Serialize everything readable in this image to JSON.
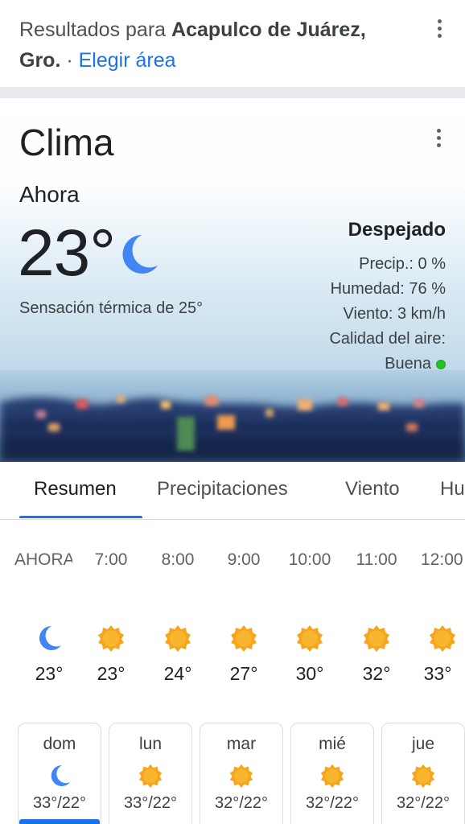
{
  "header": {
    "results_prefix": "Resultados para ",
    "location_line1": "Acapulco de Juárez,",
    "location_line2": "Gro.",
    "separator": " · ",
    "change_area": "Elegir área",
    "menu_icon": "more-vert-icon"
  },
  "weather": {
    "title": "Clima",
    "menu_icon": "more-vert-icon",
    "now_label": "Ahora",
    "temperature": "23°",
    "condition_icon": "moon-icon",
    "feels_like": "Sensación térmica de 25°",
    "condition": "Despejado",
    "precip": "Precip.: 0 %",
    "humidity": "Humedad: 76 %",
    "wind": "Viento: 3 km/h",
    "air_quality_label": "Calidad del aire:",
    "air_quality_value": "Buena",
    "air_quality_color": "#1ec71e"
  },
  "tabs": [
    {
      "label": "Resumen",
      "active": true
    },
    {
      "label": "Precipitaciones",
      "active": false
    },
    {
      "label": "Viento",
      "active": false
    },
    {
      "label": "Hu",
      "active": false
    }
  ],
  "hourly": [
    {
      "time": "AHORA",
      "icon": "moon-icon",
      "temp": "23°"
    },
    {
      "time": "7:00",
      "icon": "sun-icon",
      "temp": "23°"
    },
    {
      "time": "8:00",
      "icon": "sun-icon",
      "temp": "24°"
    },
    {
      "time": "9:00",
      "icon": "sun-icon",
      "temp": "27°"
    },
    {
      "time": "10:00",
      "icon": "sun-icon",
      "temp": "30°"
    },
    {
      "time": "11:00",
      "icon": "sun-icon",
      "temp": "32°"
    },
    {
      "time": "12:00",
      "icon": "sun-icon",
      "temp": "33°"
    }
  ],
  "daily": [
    {
      "day": "dom",
      "icon": "moon-icon",
      "temps": "33°/22°",
      "selected": true
    },
    {
      "day": "lun",
      "icon": "sun-icon",
      "temps": "33°/22°",
      "selected": false
    },
    {
      "day": "mar",
      "icon": "sun-icon",
      "temps": "32°/22°",
      "selected": false
    },
    {
      "day": "mié",
      "icon": "sun-icon",
      "temps": "32°/22°",
      "selected": false
    },
    {
      "day": "jue",
      "icon": "sun-icon",
      "temps": "32°/22°",
      "selected": false
    }
  ],
  "colors": {
    "accent": "#1a73e8",
    "moon": "#4285f4",
    "sun": "#f6a51c"
  }
}
